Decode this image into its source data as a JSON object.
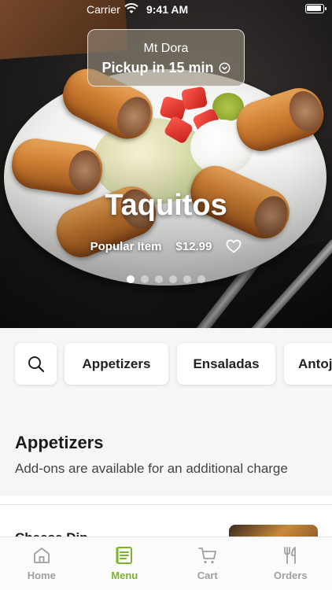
{
  "status_bar": {
    "carrier": "Carrier",
    "time": "9:41 AM"
  },
  "location": {
    "city": "Mt Dora",
    "pickup": "Pickup in 15 min"
  },
  "hero": {
    "title": "Taquitos",
    "tag": "Popular Item",
    "price": "$12.99",
    "carousel": {
      "count": 6,
      "active_index": 0
    }
  },
  "categories": [
    "Appetizers",
    "Ensaladas",
    "Antojitos"
  ],
  "section": {
    "title": "Appetizers",
    "subtitle": "Add-ons are available for an additional charge"
  },
  "first_item": {
    "name": "Cheese Dip"
  },
  "tabs": [
    {
      "label": "Home",
      "icon": "home-icon",
      "active": false
    },
    {
      "label": "Menu",
      "icon": "menu-icon",
      "active": true
    },
    {
      "label": "Cart",
      "icon": "cart-icon",
      "active": false
    },
    {
      "label": "Orders",
      "icon": "orders-icon",
      "active": false
    }
  ],
  "colors": {
    "accent": "#7bb32e",
    "inactive_tab": "#a0a0a0"
  }
}
